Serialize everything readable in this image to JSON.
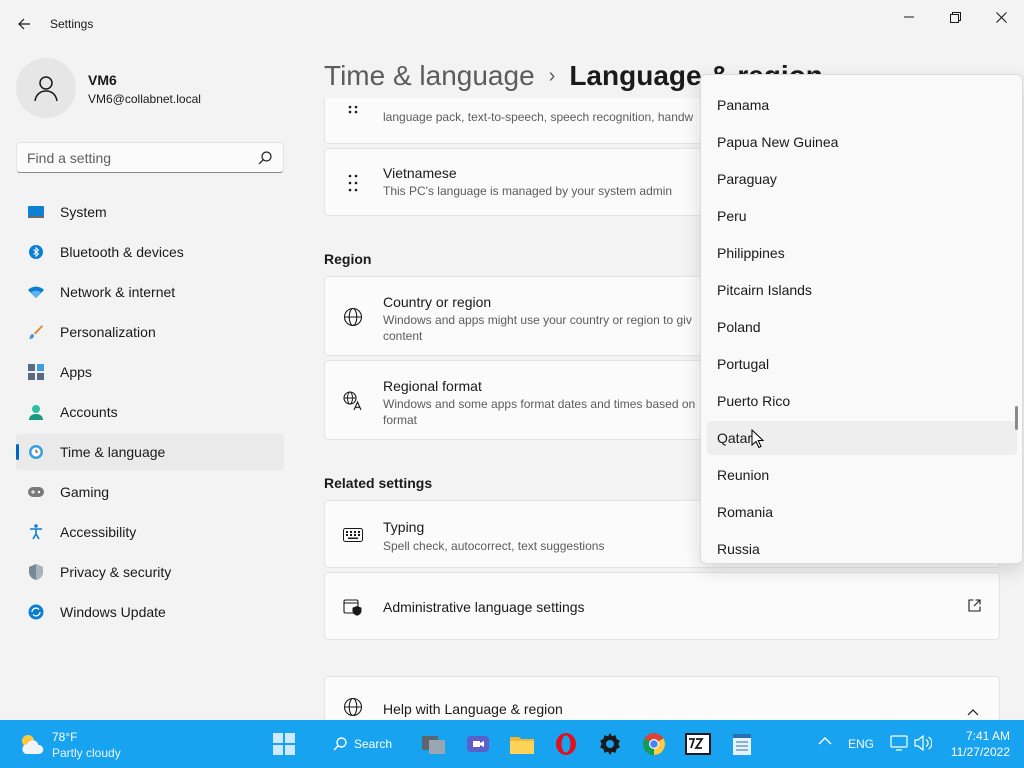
{
  "window": {
    "title": "Settings"
  },
  "profile": {
    "name": "VM6",
    "email": "VM6@collabnet.local"
  },
  "search": {
    "placeholder": "Find a setting"
  },
  "nav": {
    "items": [
      {
        "label": "System",
        "icon": "system-icon"
      },
      {
        "label": "Bluetooth & devices",
        "icon": "bluetooth-icon"
      },
      {
        "label": "Network & internet",
        "icon": "wifi-icon"
      },
      {
        "label": "Personalization",
        "icon": "brush-icon"
      },
      {
        "label": "Apps",
        "icon": "apps-icon"
      },
      {
        "label": "Accounts",
        "icon": "person-icon"
      },
      {
        "label": "Time & language",
        "icon": "globe-clock-icon",
        "active": true
      },
      {
        "label": "Gaming",
        "icon": "gamepad-icon"
      },
      {
        "label": "Accessibility",
        "icon": "accessibility-icon"
      },
      {
        "label": "Privacy & security",
        "icon": "shield-icon"
      },
      {
        "label": "Windows Update",
        "icon": "update-icon"
      }
    ]
  },
  "breadcrumb": {
    "parent": "Time & language",
    "separator": "›",
    "current": "Language & region"
  },
  "main": {
    "language_partial_desc": "language pack, text-to-speech, speech recognition, handw",
    "vietnamese": {
      "title": "Vietnamese",
      "desc": "This PC's language is managed by your system admin"
    },
    "region_heading": "Region",
    "country": {
      "title": "Country or region",
      "desc": "Windows and apps might use your country or region to giv content"
    },
    "regional_format": {
      "title": "Regional format",
      "desc": "Windows and some apps format dates and times based on format"
    },
    "related_heading": "Related settings",
    "typing": {
      "title": "Typing",
      "desc": "Spell check, autocorrect, text suggestions"
    },
    "admin": {
      "title": "Administrative language settings"
    },
    "help": {
      "title": "Help with Language & region"
    }
  },
  "dropdown": {
    "items": [
      "Panama",
      "Papua New Guinea",
      "Paraguay",
      "Peru",
      "Philippines",
      "Pitcairn Islands",
      "Poland",
      "Portugal",
      "Puerto Rico",
      "Qatar",
      "Reunion",
      "Romania",
      "Russia"
    ],
    "hovered": "Qatar"
  },
  "taskbar": {
    "weather_temp": "78°F",
    "weather_cond": "Partly cloudy",
    "search_label": "Search",
    "lang": "ENG",
    "time": "7:41 AM",
    "date": "11/27/2022"
  },
  "colors": {
    "accent": "#0067c0",
    "taskbar": "#18a3f0"
  }
}
